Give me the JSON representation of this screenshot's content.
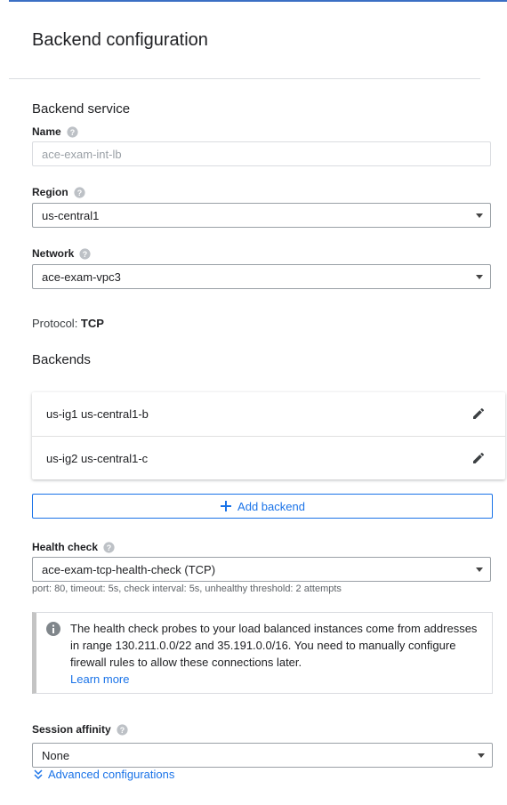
{
  "page": {
    "title": "Backend configuration"
  },
  "backend_service": {
    "heading": "Backend service",
    "name": {
      "label": "Name",
      "value": "ace-exam-int-lb"
    },
    "region": {
      "label": "Region",
      "value": "us-central1"
    },
    "network": {
      "label": "Network",
      "value": "ace-exam-vpc3"
    },
    "protocol": {
      "label": "Protocol: ",
      "value": "TCP"
    }
  },
  "backends": {
    "heading": "Backends",
    "items": [
      {
        "label": "us-ig1 us-central1-b"
      },
      {
        "label": "us-ig2 us-central1-c"
      }
    ],
    "add_label": "Add backend"
  },
  "health_check": {
    "label": "Health check",
    "value": "ace-exam-tcp-health-check (TCP)",
    "details": "port: 80, timeout: 5s, check interval: 5s, unhealthy threshold: 2 attempts",
    "info": "The health check probes to your load balanced instances come from addresses in range 130.211.0.0/22 and 35.191.0.0/16. You need to manually configure firewall rules to allow these connections later.",
    "learn_more": "Learn more"
  },
  "session_affinity": {
    "label": "Session affinity",
    "value": "None"
  },
  "advanced": {
    "label": "Advanced configurations"
  },
  "colors": {
    "accent": "#1a73e8",
    "top_line": "#3b6fc4"
  }
}
